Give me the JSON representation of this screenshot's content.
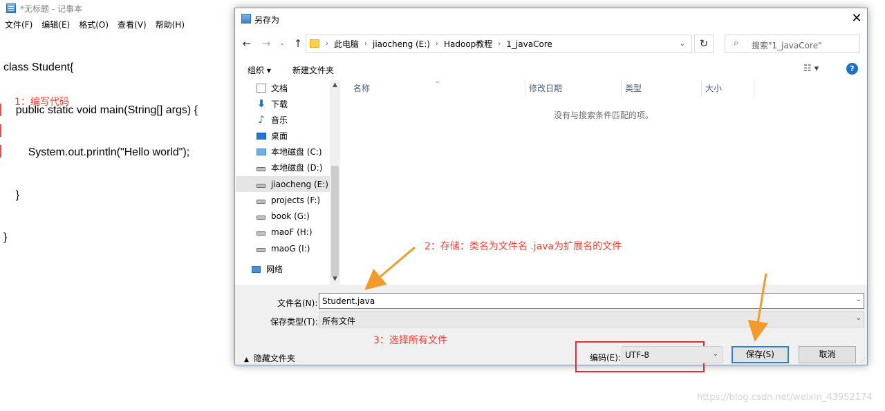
{
  "notepad": {
    "title": "*无标题 - 记事本",
    "menu": [
      "文件(F)",
      "编辑(E)",
      "格式(O)",
      "查看(V)",
      "帮助(H)"
    ],
    "code_lines": [
      "class Student{",
      "    public static void main(String[] args) {",
      "        System.out.println(\"Hello world\");",
      "    }",
      "}"
    ]
  },
  "annotations": {
    "step1": "1：编写代码",
    "step2": "2：存储：类名为文件名 .java为扩展名的文件",
    "step3": "3：选择所有文件",
    "color": "#ff3b30"
  },
  "dialog": {
    "title": "另存为",
    "close_glyph": "✕",
    "breadcrumb": [
      "此电脑",
      "jiaocheng (E:)",
      "Hadoop教程",
      "1_javaCore"
    ],
    "search_placeholder": "搜索\"1_javaCore\"",
    "toolbar": {
      "organize": "组织 ▾",
      "new_folder": "新建文件夹",
      "view": "☷ ▾",
      "help": "?"
    },
    "nav_items": [
      {
        "label": "文档",
        "icon": "document-icon"
      },
      {
        "label": "下载",
        "icon": "download-icon"
      },
      {
        "label": "音乐",
        "icon": "music-icon"
      },
      {
        "label": "桌面",
        "icon": "desktop-icon"
      },
      {
        "label": "本地磁盘 (C:)",
        "icon": "system-drive-icon"
      },
      {
        "label": "本地磁盘 (D:)",
        "icon": "drive-icon"
      },
      {
        "label": "jiaocheng (E:)",
        "icon": "drive-icon",
        "selected": true
      },
      {
        "label": "projects (F:)",
        "icon": "drive-icon"
      },
      {
        "label": "book (G:)",
        "icon": "drive-icon"
      },
      {
        "label": "maoF (H:)",
        "icon": "drive-icon"
      },
      {
        "label": "maoG (I:)",
        "icon": "drive-icon"
      },
      {
        "label": "网络",
        "icon": "network-icon"
      }
    ],
    "columns": {
      "name": "名称",
      "date": "修改日期",
      "type": "类型",
      "size": "大小"
    },
    "empty_message": "没有与搜索条件匹配的项。",
    "filename_label": "文件名(N):",
    "filename_value": "Student.java",
    "filetype_label": "保存类型(T):",
    "filetype_value": "所有文件",
    "hide_folders": "隐藏文件夹",
    "encoding_label": "编码(E):",
    "encoding_value": "UTF-8",
    "save_button": "保存(S)",
    "cancel_button": "取消",
    "accent_color": "#2f7fd1"
  },
  "watermark": "https://blog.csdn.net/weixin_43952174"
}
